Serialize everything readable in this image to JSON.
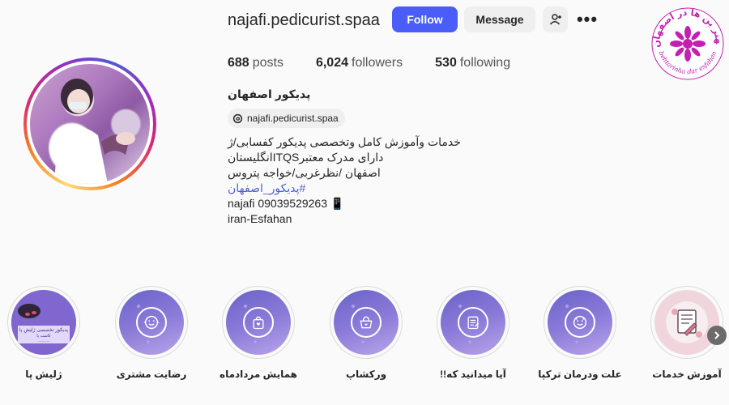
{
  "profile": {
    "username": "najafi.pedicurist.spaa",
    "follow_label": "Follow",
    "message_label": "Message",
    "more_label": "•••",
    "stats": {
      "posts_count": "688",
      "posts_label": "posts",
      "followers_count": "6,024",
      "followers_label": "followers",
      "following_count": "530",
      "following_label": "following"
    },
    "full_name": "پدیکور اصفهان",
    "threads_handle": "najafi.pedicurist.spaa",
    "bio": {
      "line1": "خدمات وآموزش کامل وتخصصی پدیکور کفسابی/ژ",
      "line2": "دارای مدرک معتبرITQSانگلیستان",
      "line3": "اصفهان /نظرغربی/خواجه پتروس",
      "hashtag": "#پدیکور_اصفهان",
      "line5": "najafi 09039529263 📱",
      "line6": "iran-Esfahan"
    }
  },
  "logo": {
    "top_text": "بهتر ین ها در اصفهان",
    "bottom_text": "behtarinha dar esfahan"
  },
  "highlights": [
    {
      "label": "ژلیش پا",
      "icon": "photo"
    },
    {
      "label": "رضایت مشتری",
      "icon": "face-icon"
    },
    {
      "label": "همایش مردادماه",
      "icon": "shopping-bag-icon"
    },
    {
      "label": "ورکشاپ",
      "icon": "handbag-icon"
    },
    {
      "label": "آیا میدانید که!!",
      "icon": "notepad-icon"
    },
    {
      "label": "علت ودرمان ترکپا",
      "icon": "face-icon"
    },
    {
      "label": "آموزش خدمات",
      "icon": "photo-pedicure"
    }
  ],
  "colors": {
    "follow_button": "#4a5df9",
    "hashtag": "#4d5fd0",
    "highlight_bg": "#7b6fd3"
  }
}
